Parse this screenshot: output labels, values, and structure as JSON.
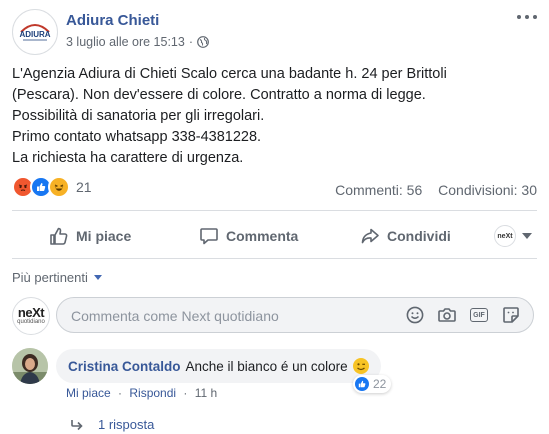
{
  "post": {
    "page_name": "Adiura Chieti",
    "logo_text": "ADIURA",
    "date": "3 luglio alle ore 15:13",
    "text_lines": [
      "L'Agenzia Adiura di Chieti Scalo cerca una badante h. 24 per Brittoli",
      "(Pescara). Non dev'essere di colore. Contratto a norma di legge.",
      "Possibilità di sanatoria per gli irregolari.",
      "Primo contato whatsapp 338-4381228.",
      "La richiesta ha carattere di urgenza."
    ],
    "reactions": [
      "angry",
      "like",
      "haha"
    ],
    "reaction_count": "21",
    "comments_stat": "Commenti: 56",
    "shares_stat": "Condivisioni: 30"
  },
  "actions": {
    "like": "Mi piace",
    "comment": "Commenta",
    "share": "Condividi",
    "profile_mini": "neXt"
  },
  "comments_section": {
    "sort_label": "Più pertinenti",
    "composer_avatar_text": "neXt",
    "composer_avatar_sub": "quotidiano",
    "composer_placeholder": "Commenta come Next quotidiano",
    "composer_icons": [
      "emoji-icon",
      "camera-icon",
      "gif-icon",
      "sticker-icon"
    ]
  },
  "comment": {
    "author": "Cristina Contaldo",
    "text": "Anche il bianco é un colore",
    "emoji": "winking-face",
    "like_count": "22",
    "like_label": "Mi piace",
    "reply_label": "Rispondi",
    "time": "11 h",
    "replies_label": "1 risposta"
  },
  "colors": {
    "link": "#385898",
    "meta": "#606770",
    "brand_blue": "#1877f2"
  }
}
